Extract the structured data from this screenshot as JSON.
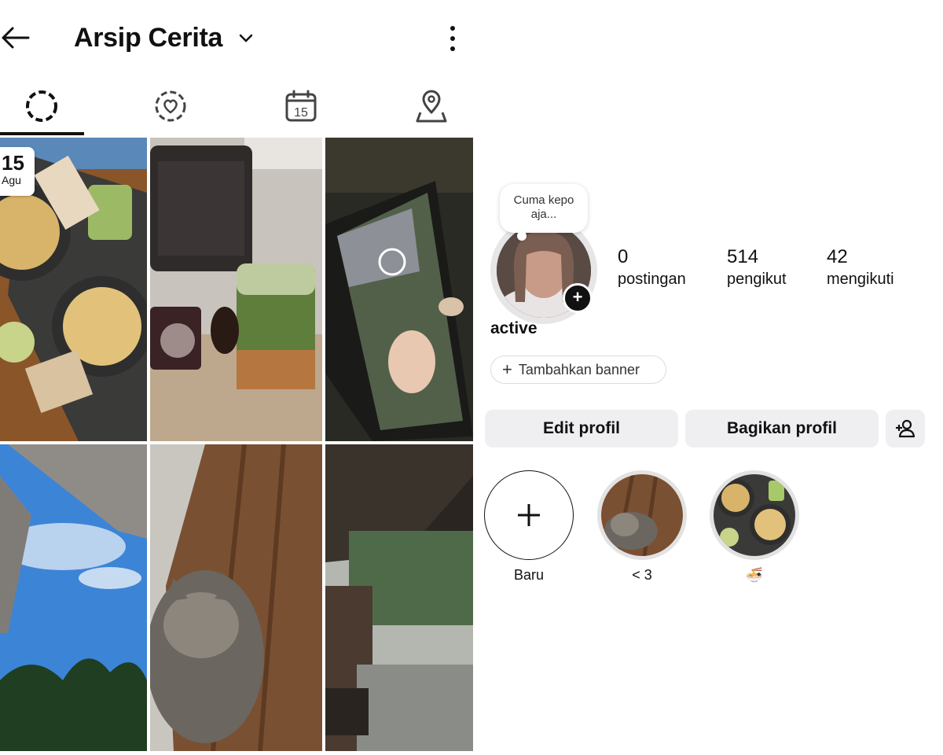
{
  "archive": {
    "title": "Arsip Cerita",
    "tabs": [
      {
        "name": "stories",
        "selected": true
      },
      {
        "name": "favorites",
        "selected": false
      },
      {
        "name": "calendar",
        "selected": false,
        "icon_text": "15"
      },
      {
        "name": "locations",
        "selected": false
      }
    ],
    "first_story_date": {
      "day": "15",
      "month": "Agu"
    }
  },
  "profile": {
    "note": "Cuma kepo aja...",
    "username": "active",
    "stats": {
      "posts": {
        "value": "0",
        "label": "postingan"
      },
      "followers": {
        "value": "514",
        "label": "pengikut"
      },
      "following": {
        "value": "42",
        "label": "mengikuti"
      }
    },
    "add_banner_label": "Tambahkan banner",
    "edit_button": "Edit profil",
    "share_button": "Bagikan profil",
    "highlights": [
      {
        "label": "Baru"
      },
      {
        "label": "< 3"
      },
      {
        "label": "🍜"
      }
    ]
  },
  "colors": {
    "accent": "#111111",
    "button_bg": "#efeff1",
    "ring": "#e6e6e6"
  }
}
